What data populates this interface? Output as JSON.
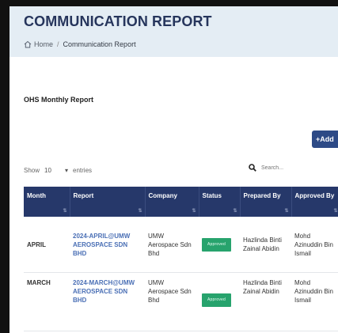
{
  "header": {
    "title": "COMMUNICATION REPORT",
    "breadcrumb": {
      "home": "Home",
      "current": "Communication Report"
    }
  },
  "section": {
    "title": "OHS Monthly Report"
  },
  "toolbar": {
    "add_label": "+Add"
  },
  "table_controls": {
    "show_label": "Show",
    "entries_value": "10",
    "entries_label": "entries",
    "search_placeholder": "Search..."
  },
  "table": {
    "columns": [
      "Month",
      "Report",
      "Company",
      "Status",
      "Prepared By",
      "Approved By"
    ],
    "rows": [
      {
        "month": "APRIL",
        "report": "2024-APRIL@UMW AEROSPACE SDN BHD",
        "company": "UMW Aerospace Sdn Bhd",
        "status": "Approved",
        "prepared_by": "Hazlinda Binti Zainal Abidin",
        "approved_by": "Mohd Azinuddin Bin Ismail"
      },
      {
        "month": "MARCH",
        "report": "2024-MARCH@UMW AEROSPACE SDN BHD",
        "company": "UMW Aerospace Sdn Bhd",
        "status": "Approved",
        "prepared_by": "Hazlinda Binti Zainal Abidin",
        "approved_by": "Mohd Azinuddin Bin Ismail"
      }
    ]
  },
  "colors": {
    "header_bg": "#e4edf4",
    "title": "#26355c",
    "table_header": "#26386a",
    "add_button": "#2d4a86",
    "approved_badge": "#27a36d",
    "report_link": "#4a6fb5"
  },
  "icons": {
    "breadcrumb_home": "home-icon",
    "search": "search-icon",
    "entries_dropdown": "chevron-down-icon"
  }
}
